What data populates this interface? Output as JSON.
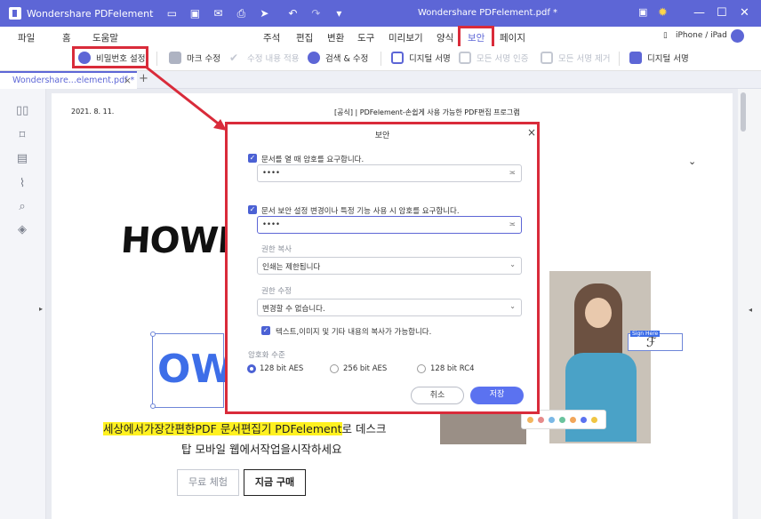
{
  "app": {
    "name": "Wondershare PDFelement",
    "document_title": "Wondershare PDFelement.pdf *"
  },
  "menu": {
    "file": "파일",
    "home": "홈",
    "help": "도움말",
    "comment": "주석",
    "edit": "편집",
    "convert": "변환",
    "tool": "도구",
    "preview": "미리보기",
    "form": "양식",
    "security": "보안",
    "page": "페이지",
    "device": "iPhone / iPad"
  },
  "toolbar": {
    "password_setting": "비밀번호 설정",
    "mark_edit": "마크 수정",
    "apply_edit": "수정 내용 적용",
    "search_edit": "검색 & 수정",
    "digital_sign": "디지털 서명",
    "verify_all": "모든 서명 인증",
    "remove_all": "모든 서명 제거",
    "digital_sign2": "디지털 서명"
  },
  "tab": {
    "label": "Wondershare...element.pdf *",
    "close": "×",
    "add": "+"
  },
  "page": {
    "date": "2021. 8. 11.",
    "header": "[공식] | PDFelement-손쉽게 사용 가능한 PDF편집 프로그램",
    "howe_text": "HOWEV",
    "ow_text": "OW",
    "tagline_highlight": "세상에서가장간편한PDF 문서편집기 PDFelement",
    "tagline_rest": "로 데스크",
    "tagline_line2": "탑 모바일 웹에서작업을시작하세요",
    "free_trial": "무료 체험",
    "buy_now": "지금 구매",
    "sign_here": "Sign Here"
  },
  "dialog": {
    "title": "보안",
    "close": "×",
    "open_password_label": "문서를 열 때 암호를 요구합니다.",
    "open_password_value": "••••",
    "permission_password_label": "문서 보안 설정 변경이나 특정 기능 사용 시 암호를 요구합니다.",
    "permission_password_value": "••••",
    "print_permission_label": "권한 복사",
    "print_permission_value": "인쇄는 제한됩니다",
    "change_permission_label": "권한 수정",
    "change_permission_value": "변경할 수 없습니다.",
    "copy_label": "텍스트,이미지 및 기타 내용의 복사가 가능합니다.",
    "encryption_label": "암호화 수준",
    "aes128": "128 bit AES",
    "aes256": "256 bit AES",
    "rc4": "128 bit RC4",
    "cancel": "취소",
    "save": "저장"
  },
  "colors": {
    "brand": "#5d66d6",
    "highlight": "#d92b3a",
    "primary_button": "#5b72f0"
  }
}
